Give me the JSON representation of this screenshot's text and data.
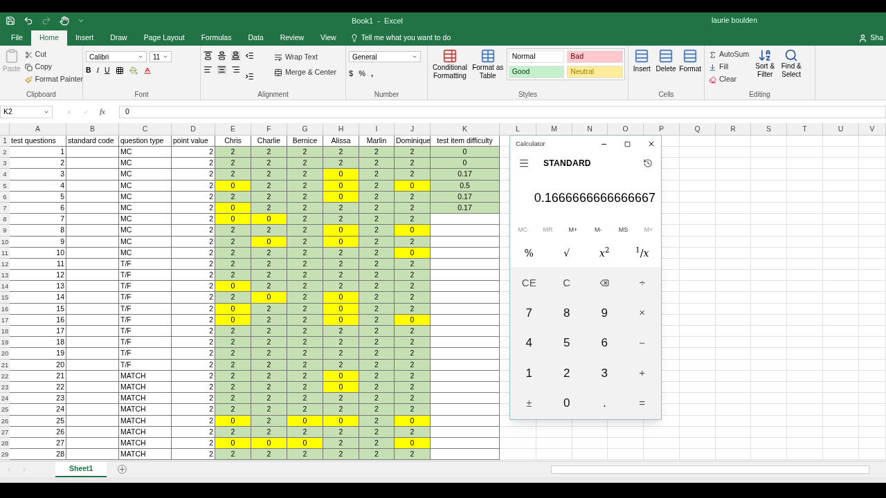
{
  "title_bar": {
    "title": "Book1  -  Excel",
    "user": "laurie boulden"
  },
  "menu_tabs": [
    {
      "label": "File",
      "selected": false
    },
    {
      "label": "Home",
      "selected": true
    },
    {
      "label": "Insert",
      "selected": false
    },
    {
      "label": "Draw",
      "selected": false
    },
    {
      "label": "Page Layout",
      "selected": false
    },
    {
      "label": "Formulas",
      "selected": false
    },
    {
      "label": "Data",
      "selected": false
    },
    {
      "label": "Review",
      "selected": false
    },
    {
      "label": "View",
      "selected": false
    }
  ],
  "tell_me": "Tell me what you want to do",
  "share": "Sha",
  "clipboard": {
    "paste": "Paste",
    "cut": "Cut",
    "copy": "Copy",
    "format_painter": "Format Painter",
    "label": "Clipboard"
  },
  "font": {
    "name": "Calibri",
    "size": "11",
    "bold": "B",
    "italic": "I",
    "underline": "U",
    "label": "Font"
  },
  "alignment": {
    "wrap_text": "Wrap Text",
    "merge": "Merge & Center",
    "label": "Alignment"
  },
  "number": {
    "format": "General",
    "currency": "$",
    "percent": "%",
    "comma": ",",
    "label": "Number"
  },
  "styles": {
    "conditional": "Conditional Formatting",
    "format_as_table": "Format as Table",
    "label": "Styles",
    "presets": [
      {
        "label": "Normal",
        "color": "#ffffff"
      },
      {
        "label": "Bad",
        "color": "#ffc7ce"
      },
      {
        "label": "Good",
        "color": "#c6efce"
      },
      {
        "label": "Neutral",
        "color": "#ffeb9c"
      }
    ]
  },
  "cells": {
    "buttons": [
      "Insert",
      "Delete",
      "Format"
    ],
    "label": "Cells"
  },
  "editing": {
    "autosum": "AutoSum",
    "fill": "Fill",
    "clear": "Clear",
    "sort": "Sort & Filter",
    "find": "Find & Select",
    "label": "Editing"
  },
  "formula_bar": {
    "name_box": "K2",
    "fx": "fx",
    "value": "0"
  },
  "columns": [
    "A",
    "B",
    "C",
    "D",
    "E",
    "F",
    "G",
    "H",
    "I",
    "J",
    "K",
    "L",
    "M",
    "N",
    "O",
    "P",
    "Q",
    "R",
    "S",
    "T",
    "U",
    "V"
  ],
  "header_row_number": "1",
  "header_row": [
    "test questions",
    "standard code",
    "question type",
    "point value",
    "Chris",
    "Charlie",
    "Bernice",
    "Alissa",
    "Marlin",
    "Dominique",
    "test item difficulty"
  ],
  "rows": [
    {
      "number": "2",
      "question": "1",
      "type": "MC",
      "points": "2",
      "scores": [
        "2",
        "2",
        "2",
        "2",
        "2",
        "2"
      ],
      "highlight": [
        false,
        false,
        false,
        false,
        false,
        false
      ],
      "difficulty": "0"
    },
    {
      "number": "3",
      "question": "2",
      "type": "MC",
      "points": "2",
      "scores": [
        "2",
        "2",
        "2",
        "2",
        "2",
        "2"
      ],
      "highlight": [
        false,
        false,
        false,
        false,
        false,
        false
      ],
      "difficulty": "0"
    },
    {
      "number": "4",
      "question": "3",
      "type": "MC",
      "points": "2",
      "scores": [
        "2",
        "2",
        "2",
        "0",
        "2",
        "2"
      ],
      "highlight": [
        false,
        false,
        false,
        true,
        false,
        false
      ],
      "difficulty": "0.17"
    },
    {
      "number": "5",
      "question": "4",
      "type": "MC",
      "points": "2",
      "scores": [
        "0",
        "2",
        "2",
        "0",
        "2",
        "0"
      ],
      "highlight": [
        true,
        false,
        false,
        true,
        false,
        true
      ],
      "difficulty": "0.5"
    },
    {
      "number": "6",
      "question": "5",
      "type": "MC",
      "points": "2",
      "scores": [
        "2",
        "2",
        "2",
        "0",
        "2",
        "2"
      ],
      "highlight": [
        false,
        false,
        false,
        true,
        false,
        false
      ],
      "difficulty": "0.17"
    },
    {
      "number": "7",
      "question": "6",
      "type": "MC",
      "points": "2",
      "scores": [
        "0",
        "2",
        "2",
        "2",
        "2",
        "2"
      ],
      "highlight": [
        true,
        false,
        false,
        false,
        false,
        false
      ],
      "difficulty": "0.17"
    },
    {
      "number": "8",
      "question": "7",
      "type": "MC",
      "points": "2",
      "scores": [
        "0",
        "0",
        "2",
        "2",
        "2",
        "2"
      ],
      "highlight": [
        true,
        true,
        false,
        false,
        false,
        false
      ]
    },
    {
      "number": "9",
      "question": "8",
      "type": "MC",
      "points": "2",
      "scores": [
        "2",
        "2",
        "2",
        "0",
        "2",
        "0"
      ],
      "highlight": [
        false,
        false,
        false,
        true,
        false,
        true
      ]
    },
    {
      "number": "10",
      "question": "9",
      "type": "MC",
      "points": "2",
      "scores": [
        "2",
        "0",
        "2",
        "0",
        "2",
        "2"
      ],
      "highlight": [
        false,
        true,
        false,
        true,
        false,
        false
      ]
    },
    {
      "number": "11",
      "question": "10",
      "type": "MC",
      "points": "2",
      "scores": [
        "2",
        "2",
        "2",
        "2",
        "2",
        "0"
      ],
      "highlight": [
        false,
        false,
        false,
        false,
        false,
        true
      ]
    },
    {
      "number": "12",
      "question": "11",
      "type": "T/F",
      "points": "2",
      "scores": [
        "2",
        "2",
        "2",
        "2",
        "2",
        "2"
      ],
      "highlight": [
        false,
        false,
        false,
        false,
        false,
        false
      ]
    },
    {
      "number": "13",
      "question": "12",
      "type": "T/F",
      "points": "2",
      "scores": [
        "2",
        "2",
        "2",
        "2",
        "2",
        "2"
      ],
      "highlight": [
        false,
        false,
        false,
        false,
        false,
        false
      ]
    },
    {
      "number": "14",
      "question": "13",
      "type": "T/F",
      "points": "2",
      "scores": [
        "0",
        "2",
        "2",
        "2",
        "2",
        "2"
      ],
      "highlight": [
        true,
        false,
        false,
        false,
        false,
        false
      ]
    },
    {
      "number": "15",
      "question": "14",
      "type": "T/F",
      "points": "2",
      "scores": [
        "2",
        "0",
        "2",
        "0",
        "2",
        "2"
      ],
      "highlight": [
        false,
        true,
        false,
        true,
        false,
        false
      ]
    },
    {
      "number": "16",
      "question": "15",
      "type": "T/F",
      "points": "2",
      "scores": [
        "0",
        "2",
        "2",
        "0",
        "2",
        "2"
      ],
      "highlight": [
        true,
        false,
        false,
        true,
        false,
        false
      ]
    },
    {
      "number": "17",
      "question": "16",
      "type": "T/F",
      "points": "2",
      "scores": [
        "0",
        "2",
        "2",
        "0",
        "2",
        "0"
      ],
      "highlight": [
        true,
        false,
        false,
        true,
        false,
        true
      ]
    },
    {
      "number": "18",
      "question": "17",
      "type": "T/F",
      "points": "2",
      "scores": [
        "2",
        "2",
        "2",
        "2",
        "2",
        "2"
      ],
      "highlight": [
        false,
        false,
        false,
        false,
        false,
        false
      ]
    },
    {
      "number": "19",
      "question": "18",
      "type": "T/F",
      "points": "2",
      "scores": [
        "2",
        "2",
        "2",
        "2",
        "2",
        "2"
      ],
      "highlight": [
        false,
        false,
        false,
        false,
        false,
        false
      ]
    },
    {
      "number": "20",
      "question": "19",
      "type": "T/F",
      "points": "2",
      "scores": [
        "2",
        "2",
        "2",
        "2",
        "2",
        "2"
      ],
      "highlight": [
        false,
        false,
        false,
        false,
        false,
        false
      ]
    },
    {
      "number": "21",
      "question": "20",
      "type": "T/F",
      "points": "2",
      "scores": [
        "2",
        "2",
        "2",
        "2",
        "2",
        "2"
      ],
      "highlight": [
        false,
        false,
        false,
        false,
        false,
        false
      ]
    },
    {
      "number": "22",
      "question": "21",
      "type": "MATCH",
      "points": "2",
      "scores": [
        "2",
        "2",
        "2",
        "0",
        "2",
        "2"
      ],
      "highlight": [
        false,
        false,
        false,
        true,
        false,
        false
      ]
    },
    {
      "number": "23",
      "question": "22",
      "type": "MATCH",
      "points": "2",
      "scores": [
        "2",
        "2",
        "2",
        "0",
        "2",
        "2"
      ],
      "highlight": [
        false,
        false,
        false,
        true,
        false,
        false
      ]
    },
    {
      "number": "24",
      "question": "23",
      "type": "MATCH",
      "points": "2",
      "scores": [
        "2",
        "2",
        "2",
        "2",
        "2",
        "2"
      ],
      "highlight": [
        false,
        false,
        false,
        false,
        false,
        false
      ]
    },
    {
      "number": "25",
      "question": "24",
      "type": "MATCH",
      "points": "2",
      "scores": [
        "2",
        "2",
        "2",
        "2",
        "2",
        "2"
      ],
      "highlight": [
        false,
        false,
        false,
        false,
        false,
        false
      ]
    },
    {
      "number": "26",
      "question": "25",
      "type": "MATCH",
      "points": "2",
      "scores": [
        "0",
        "2",
        "0",
        "0",
        "2",
        "0"
      ],
      "highlight": [
        true,
        false,
        true,
        true,
        false,
        true
      ]
    },
    {
      "number": "27",
      "question": "26",
      "type": "MATCH",
      "points": "2",
      "scores": [
        "2",
        "2",
        "2",
        "2",
        "2",
        "2"
      ],
      "highlight": [
        false,
        false,
        false,
        false,
        false,
        false
      ]
    },
    {
      "number": "28",
      "question": "27",
      "type": "MATCH",
      "points": "2",
      "scores": [
        "0",
        "0",
        "0",
        "2",
        "2",
        "0"
      ],
      "highlight": [
        true,
        true,
        true,
        false,
        false,
        true
      ]
    },
    {
      "number": "29",
      "question": "28",
      "type": "MATCH",
      "points": "2",
      "scores": [
        "2",
        "2",
        "2",
        "2",
        "2",
        "2"
      ],
      "highlight": [
        false,
        false,
        false,
        false,
        false,
        false
      ]
    }
  ],
  "sheet_tabs": [
    {
      "label": "Sheet1",
      "selected": true
    }
  ],
  "calculator": {
    "title": "Calculator",
    "mode": "STANDARD",
    "display": "0.1666666666666667",
    "memory": [
      {
        "label": "MC",
        "disabled": true
      },
      {
        "label": "MR",
        "disabled": true
      },
      {
        "label": "M+",
        "disabled": false
      },
      {
        "label": "M-",
        "disabled": false
      },
      {
        "label": "MS",
        "disabled": false
      },
      {
        "label": "M˅",
        "disabled": true
      }
    ],
    "keys": [
      {
        "label": "%",
        "kind": "func"
      },
      {
        "label": "√",
        "kind": "func"
      },
      {
        "label": "*x*$^{2}$",
        "kind": "func"
      },
      {
        "label": "$^{1}$/*x*",
        "kind": "func"
      },
      {
        "label": "CE",
        "kind": "op"
      },
      {
        "label": "C",
        "kind": "op"
      },
      {
        "kind": "backspace"
      },
      {
        "label": "÷",
        "kind": "op"
      },
      {
        "label": "7",
        "kind": "digit"
      },
      {
        "label": "8",
        "kind": "digit"
      },
      {
        "label": "9",
        "kind": "digit"
      },
      {
        "label": "×",
        "kind": "op"
      },
      {
        "label": "4",
        "kind": "digit"
      },
      {
        "label": "5",
        "kind": "digit"
      },
      {
        "label": "6",
        "kind": "digit"
      },
      {
        "label": "−",
        "kind": "op"
      },
      {
        "label": "1",
        "kind": "digit"
      },
      {
        "label": "2",
        "kind": "digit"
      },
      {
        "label": "3",
        "kind": "digit"
      },
      {
        "label": "+",
        "kind": "op"
      },
      {
        "label": "±",
        "kind": "op"
      },
      {
        "label": "0",
        "kind": "digit"
      },
      {
        "label": ".",
        "kind": "digit"
      },
      {
        "label": "=",
        "kind": "op"
      }
    ]
  }
}
